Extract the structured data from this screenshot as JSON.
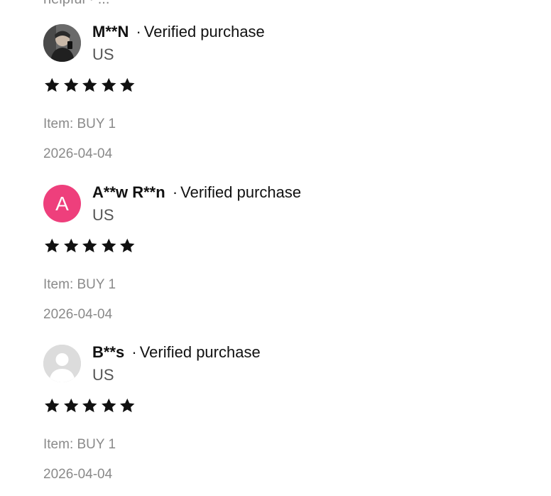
{
  "top_partial_text": "helpful · ...",
  "reviews": [
    {
      "name": "M**N",
      "separator": "·",
      "verified": "Verified purchase",
      "country": "US",
      "rating": 5,
      "avatar": {
        "type": "photo"
      },
      "item": "Item: BUY 1",
      "date": "2026-04-04"
    },
    {
      "name": "A**w R**n",
      "separator": "·",
      "verified": "Verified purchase",
      "country": "US",
      "rating": 5,
      "avatar": {
        "type": "letter",
        "letter": "A",
        "color": "#ee3f7c"
      },
      "item": "Item: BUY 1",
      "date": "2026-04-04"
    },
    {
      "name": "B**s",
      "separator": "·",
      "verified": "Verified purchase",
      "country": "US",
      "rating": 5,
      "avatar": {
        "type": "default"
      },
      "item": "Item: BUY 1",
      "date": "2026-04-04"
    }
  ],
  "colors": {
    "star": "#111111",
    "muted_text": "#8a8a8a",
    "letter_avatar_bg": "#ee3f7c",
    "default_avatar_bg": "#dcdcdc"
  }
}
